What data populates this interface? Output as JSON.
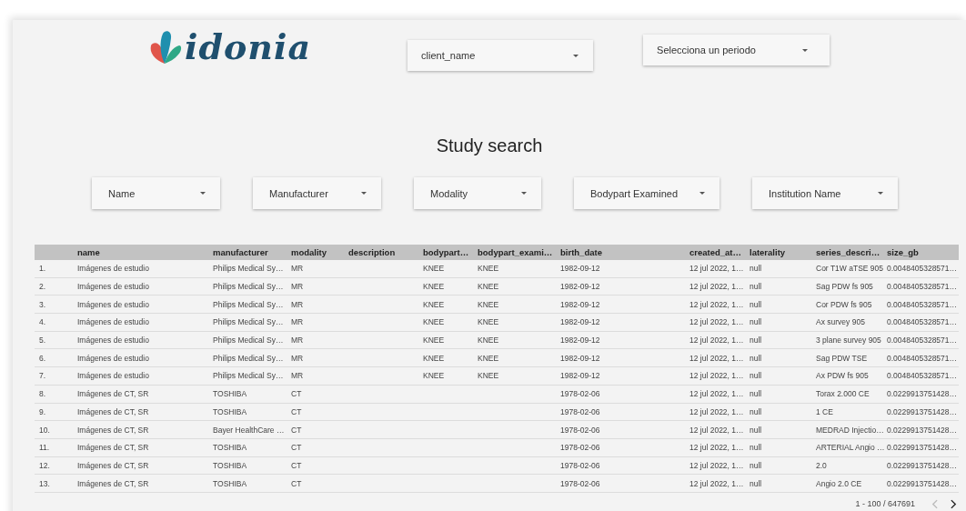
{
  "header": {
    "logo": "idonia",
    "client_select": {
      "placeholder": "client_name"
    },
    "period_select": {
      "placeholder": "Selecciona un periodo"
    }
  },
  "title": "Study search",
  "filters": [
    {
      "placeholder": "Name"
    },
    {
      "placeholder": "Manufacturer"
    },
    {
      "placeholder": "Modality"
    },
    {
      "placeholder": "Bodypart Examined"
    },
    {
      "placeholder": "Institution Name"
    }
  ],
  "table": {
    "columns": [
      "name",
      "manufacturer",
      "modality",
      "description",
      "bodypart…",
      "bodypart_exami…",
      "birth_date",
      "created_at…",
      "laterality",
      "series_descri…",
      "size_gb"
    ],
    "rows": [
      {
        "number": "1.",
        "cells": [
          "Imágenes de estudio",
          "Philips Medical Sy…",
          "MR",
          null,
          "KNEE",
          "KNEE",
          "1982-09-12",
          "12 jul 2022, 1…",
          "null",
          "Cor T1W aTSE 905",
          "0.0048405328571…"
        ]
      },
      {
        "number": "2.",
        "cells": [
          "Imágenes de estudio",
          "Philips Medical Sy…",
          "MR",
          null,
          "KNEE",
          "KNEE",
          "1982-09-12",
          "12 jul 2022, 1…",
          "null",
          "Sag PDW fs 905",
          "0.0048405328571…"
        ]
      },
      {
        "number": "3.",
        "cells": [
          "Imágenes de estudio",
          "Philips Medical Sy…",
          "MR",
          null,
          "KNEE",
          "KNEE",
          "1982-09-12",
          "12 jul 2022, 1…",
          "null",
          "Cor PDW fs 905",
          "0.0048405328571…"
        ]
      },
      {
        "number": "4.",
        "cells": [
          "Imágenes de estudio",
          "Philips Medical Sy…",
          "MR",
          null,
          "KNEE",
          "KNEE",
          "1982-09-12",
          "12 jul 2022, 1…",
          "null",
          "Ax survey 905",
          "0.0048405328571…"
        ]
      },
      {
        "number": "5.",
        "cells": [
          "Imágenes de estudio",
          "Philips Medical Sy…",
          "MR",
          null,
          "KNEE",
          "KNEE",
          "1982-09-12",
          "12 jul 2022, 1…",
          "null",
          "3 plane survey 905",
          "0.0048405328571…"
        ]
      },
      {
        "number": "6.",
        "cells": [
          "Imágenes de estudio",
          "Philips Medical Sy…",
          "MR",
          null,
          "KNEE",
          "KNEE",
          "1982-09-12",
          "12 jul 2022, 1…",
          "null",
          "Sag PDW TSE",
          "0.0048405328571…"
        ]
      },
      {
        "number": "7.",
        "cells": [
          "Imágenes de estudio",
          "Philips Medical Sy…",
          "MR",
          null,
          "KNEE",
          "KNEE",
          "1982-09-12",
          "12 jul 2022, 1…",
          "null",
          "Ax PDW fs 905",
          "0.0048405328571…"
        ]
      },
      {
        "number": "8.",
        "cells": [
          "Imágenes de CT, SR",
          "TOSHIBA",
          "CT",
          null,
          null,
          null,
          "1978-02-06",
          "12 jul 2022, 1…",
          "null",
          "Torax 2.000 CE",
          "0.0229913751428…"
        ]
      },
      {
        "number": "9.",
        "cells": [
          "Imágenes de CT, SR",
          "TOSHIBA",
          "CT",
          null,
          null,
          null,
          "1978-02-06",
          "12 jul 2022, 1…",
          "null",
          "1 CE",
          "0.0229913751428…"
        ]
      },
      {
        "number": "10.",
        "cells": [
          "Imágenes de CT, SR",
          "Bayer HealthCare …",
          "CT",
          null,
          null,
          null,
          "1978-02-06",
          "12 jul 2022, 1…",
          "null",
          "MEDRAD Injectio…",
          "0.0229913751428…"
        ]
      },
      {
        "number": "11.",
        "cells": [
          "Imágenes de CT, SR",
          "TOSHIBA",
          "CT",
          null,
          null,
          null,
          "1978-02-06",
          "12 jul 2022, 1…",
          "null",
          "ARTERIAL Angio …",
          "0.0229913751428…"
        ]
      },
      {
        "number": "12.",
        "cells": [
          "Imágenes de CT, SR",
          "TOSHIBA",
          "CT",
          null,
          null,
          null,
          "1978-02-06",
          "12 jul 2022, 1…",
          "null",
          "2.0",
          "0.0229913751428…"
        ]
      },
      {
        "number": "13.",
        "cells": [
          "Imágenes de CT, SR",
          "TOSHIBA",
          "CT",
          null,
          null,
          null,
          "1978-02-06",
          "12 jul 2022, 1…",
          "null",
          "Angio 2.0 CE",
          "0.0229913751428…"
        ]
      }
    ]
  },
  "pagination": {
    "range": "1 - 100 / 647691",
    "previous": {
      "disabled": true
    },
    "next": {
      "disabled": false
    }
  }
}
